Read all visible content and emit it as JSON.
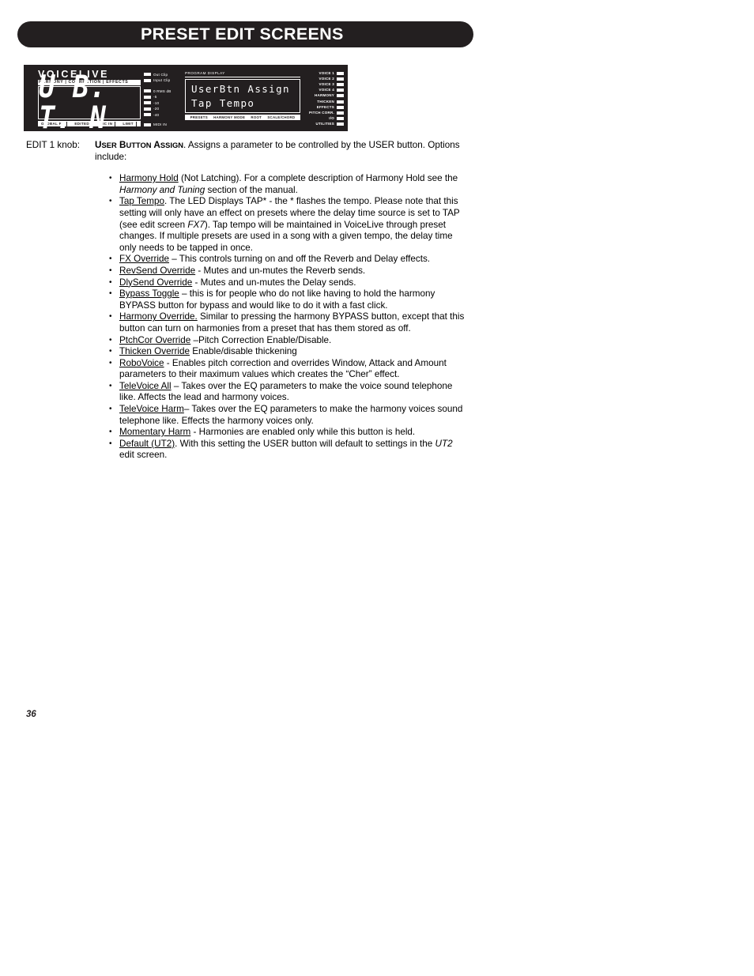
{
  "header": {
    "title": "PRESET EDIT SCREENS"
  },
  "device": {
    "logo": "VOICELIVE",
    "logo_subtitle": "HARMONY | CORRECTION | EFFECTS",
    "led_display": "U B. T. N",
    "led_status_labels": [
      "GLOBAL FX",
      "EDITED",
      "MIC IN",
      "LIMIT"
    ],
    "meters": {
      "clip": [
        {
          "label": "Out Clip"
        },
        {
          "label": "Input Clip"
        }
      ],
      "scale": [
        {
          "label": "0   RMS dB"
        },
        {
          "label": "-5"
        },
        {
          "label": "-10"
        },
        {
          "label": "-20"
        },
        {
          "label": "-40"
        }
      ],
      "midi": {
        "label": "MIDI IN"
      }
    },
    "program_display": {
      "caption": "PROGRAM DISPLAY",
      "line1": "UserBtn Assign",
      "line2": "Tap Tempo",
      "footer_labels": [
        "PRESETS",
        "HARMONY MODE",
        "ROOT",
        "SCALE/CHORD"
      ]
    },
    "right_leds": [
      "VOICE 1",
      "VOICE 2",
      "VOICE 3",
      "VOICE 4",
      "HARMONY",
      "THICKEN",
      "EFFECTS",
      "PITCH CORR.",
      "I/O",
      "UTILITIES"
    ]
  },
  "content": {
    "knob_label": "EDIT 1 knob:",
    "term_caps": "U",
    "term": {
      "word1_cap": "U",
      "word1_rest": "SER",
      "word2_cap": "B",
      "word2_rest": "UTTON",
      "word3_cap": "A",
      "word3_rest": "SSIGN"
    },
    "intro_after_term": ". Assigns a parameter to be controlled by the USER button. Options include:",
    "bullets": [
      {
        "term": "Harmony Hold",
        "text_1": " (Not Latching). For a complete description of Harmony Hold see the ",
        "italic_1": "Harmony and Tuning",
        "text_2": " section of the manual."
      },
      {
        "term": "Tap Tempo",
        "text_1": ". The LED Displays TAP* - the * flashes the tempo. Please note that this setting will only have an effect on presets where the delay time source is set to TAP (see edit screen ",
        "italic_1": "FX7",
        "text_2": ").  Tap tempo will be maintained in VoiceLive through preset changes. If multiple presets are used in a song with a given tempo, the delay time only needs to be tapped in once."
      },
      {
        "term": "FX Override",
        "text_1": " – This controls turning on and off the Reverb and Delay effects."
      },
      {
        "term": "RevSend Override",
        "text_1": " - Mutes and un-mutes the Reverb sends."
      },
      {
        "term": "DlySend Override",
        "text_1": " -   Mutes and un-mutes the Delay sends."
      },
      {
        "term": "Bypass Toggle",
        "text_1": " – this is for people who do not like having to hold the harmony BYPASS button for bypass and would like to do it with a fast click."
      },
      {
        "term": "Harmony Override.",
        "text_1": " Similar to pressing the harmony BYPASS button, except that this button can turn on harmonies from a preset that has them stored as off."
      },
      {
        "term": "PtchCor Override",
        "text_1": " –Pitch Correction Enable/Disable."
      },
      {
        "term": "Thicken Override",
        "text_1": " Enable/disable thickening"
      },
      {
        "term": "RoboVoice",
        "text_1": " - Enables pitch correction and overrides Window, Attack and Amount parameters to their maximum values which creates the “Cher” effect."
      },
      {
        "term": "TeleVoice All",
        "text_1": " – Takes over the EQ parameters to make the voice sound telephone like.  Affects the lead and harmony voices."
      },
      {
        "term": "TeleVoice Harm",
        "text_1": "– Takes over the EQ parameters to make the harmony voices sound telephone like. Effects the harmony voices only."
      },
      {
        "term": "Momentary Harm",
        "text_1": " - Harmonies are enabled only while this button is held."
      },
      {
        "term": "Default (UT2)",
        "text_1": ".  With this setting the USER button will default to settings in the ",
        "italic_1": "UT2",
        "text_2": " edit screen."
      }
    ]
  },
  "footer": {
    "page_number": "36"
  }
}
